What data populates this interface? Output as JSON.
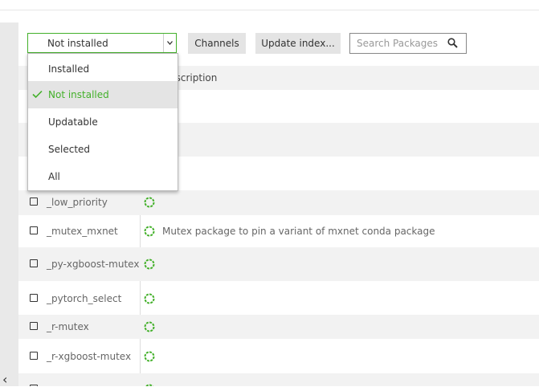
{
  "filter": {
    "value": "Not installed"
  },
  "toolbar": {
    "channels_label": "Channels",
    "update_label": "Update index...",
    "search_placeholder": "Search Packages"
  },
  "table": {
    "header_desc": "Description",
    "rows": [
      {
        "name": "_low_priority",
        "desc": ""
      },
      {
        "name": "_mutex_mxnet",
        "desc": "Mutex package to pin a variant of mxnet conda package"
      },
      {
        "name": "_py-xgboost-mutex",
        "desc": ""
      },
      {
        "name": "_pytorch_select",
        "desc": ""
      },
      {
        "name": "_r-mutex",
        "desc": ""
      },
      {
        "name": "_r-xgboost-mutex",
        "desc": ""
      }
    ]
  },
  "dropdown": {
    "items": [
      {
        "label": "Installed"
      },
      {
        "label": "Not installed"
      },
      {
        "label": "Updatable"
      },
      {
        "label": "Selected"
      },
      {
        "label": "All"
      }
    ],
    "selected": "Not installed"
  },
  "colors": {
    "accent": "#43b02a",
    "row_alt": "#f2f2f2",
    "button_bg": "#e4e4e4",
    "sidebar": "#e9e9e9"
  },
  "icons": {
    "search": "search-icon",
    "status": "package-status-icon",
    "check": "check-icon",
    "chevron": "chevron-down-icon",
    "collapse": "chevron-left-icon"
  }
}
